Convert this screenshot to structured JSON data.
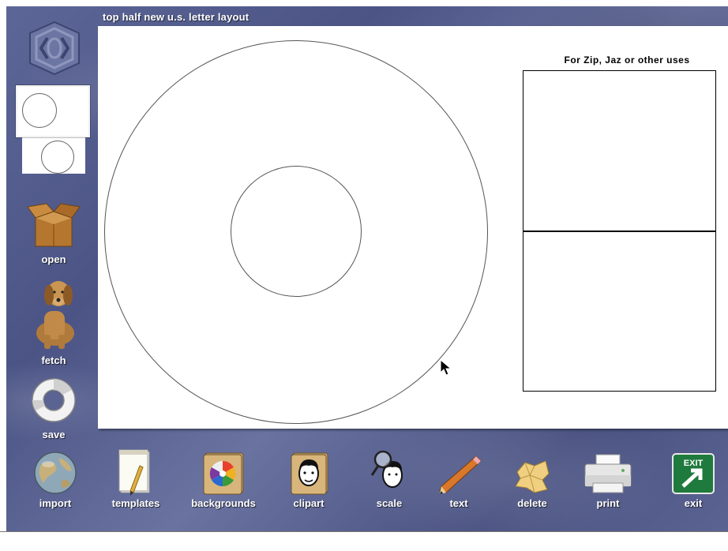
{
  "layout_title": "top half new u.s. letter layout",
  "template_panel": {
    "title": "For Zip, Jaz or other uses"
  },
  "sidebar": {
    "items": [
      {
        "name": "logo",
        "label": "",
        "icon": "logo-icon"
      },
      {
        "name": "layout-thumbnail",
        "label": "",
        "icon": "layout-thumbnail-icon"
      },
      {
        "name": "open",
        "label": "open",
        "icon": "cardboard-box-icon"
      },
      {
        "name": "fetch",
        "label": "fetch",
        "icon": "dog-icon"
      },
      {
        "name": "save",
        "label": "save",
        "icon": "life-ring-icon"
      }
    ]
  },
  "toolbar": {
    "items": [
      {
        "name": "import",
        "label": "import",
        "icon": "globe-icon"
      },
      {
        "name": "templates",
        "label": "templates",
        "icon": "notepad-pencil-icon"
      },
      {
        "name": "backgrounds",
        "label": "backgrounds",
        "icon": "color-wheel-book-icon"
      },
      {
        "name": "clipart",
        "label": "clipart",
        "icon": "face-book-icon"
      },
      {
        "name": "scale",
        "label": "scale",
        "icon": "magnifier-face-icon"
      },
      {
        "name": "text",
        "label": "text",
        "icon": "pencil-icon"
      },
      {
        "name": "delete",
        "label": "delete",
        "icon": "crumpled-paper-icon"
      },
      {
        "name": "print",
        "label": "print",
        "icon": "printer-icon"
      },
      {
        "name": "exit",
        "label": "exit",
        "icon": "exit-sign-icon",
        "sign_text": "EXIT"
      }
    ]
  },
  "colors": {
    "background": "#5a6391",
    "exit_sign": "#1f7a3d",
    "canvas": "#ffffff"
  }
}
